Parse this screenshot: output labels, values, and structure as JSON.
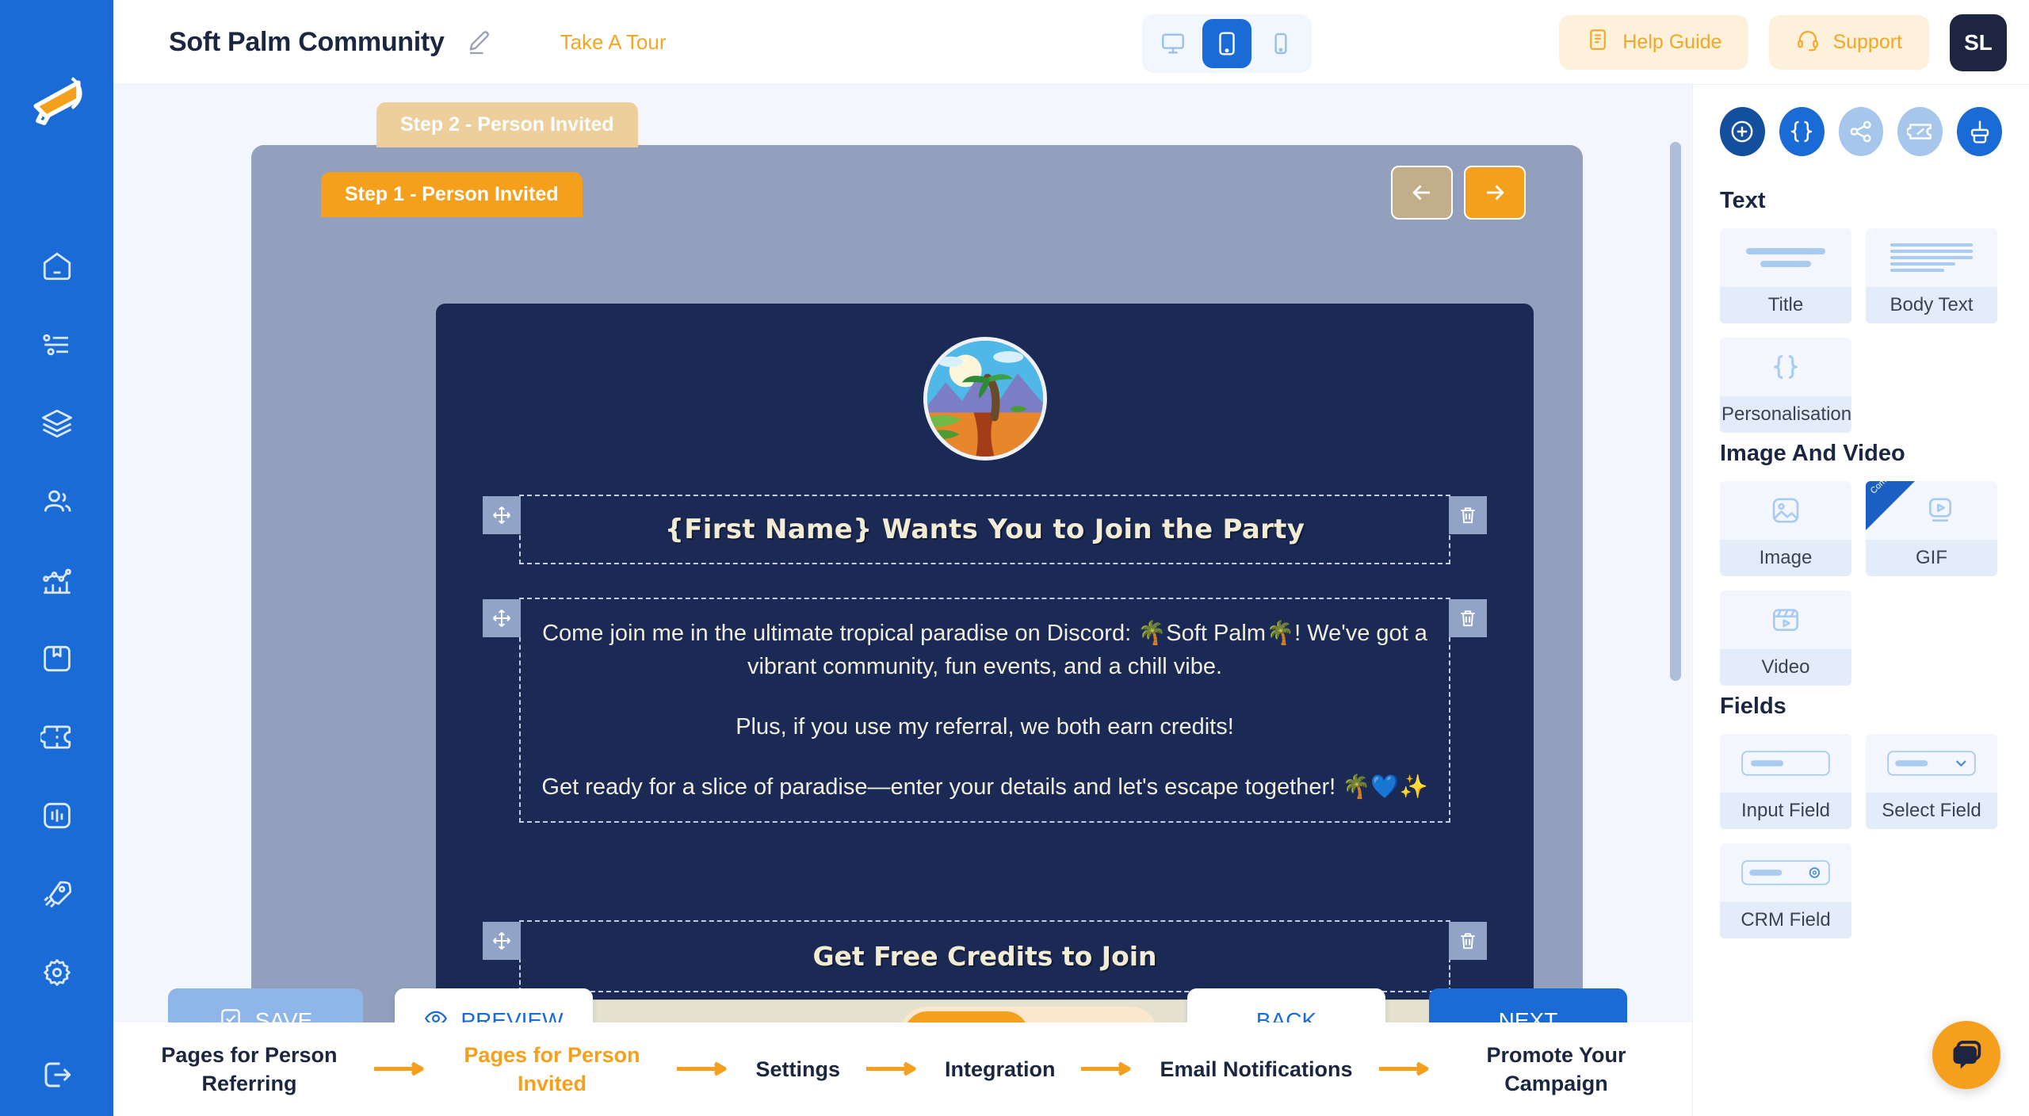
{
  "app": {
    "brand_title": "Soft Palm Community",
    "take_tour": "Take A Tour",
    "help_guide": "Help Guide",
    "support": "Support",
    "avatar_initials": "SL",
    "accent_blue": "#1b6bd6",
    "accent_orange": "#f5a01c",
    "canvas_navy": "#1b2a55",
    "frame_grey": "#93a0bd"
  },
  "device_toggle": {
    "options": [
      "desktop",
      "tablet",
      "mobile"
    ],
    "selected": "tablet"
  },
  "sidebar": {
    "logo": "megaphone-logo",
    "items": [
      {
        "icon": "home-icon",
        "name": "home"
      },
      {
        "icon": "list-icon",
        "name": "campaigns"
      },
      {
        "icon": "layers-icon",
        "name": "pages"
      },
      {
        "icon": "users-icon",
        "name": "audience"
      },
      {
        "icon": "analytics-icon",
        "name": "analytics"
      },
      {
        "icon": "box-icon",
        "name": "rewards"
      },
      {
        "icon": "ticket-icon",
        "name": "coupons"
      },
      {
        "icon": "barchart-icon",
        "name": "reports"
      },
      {
        "icon": "rocket-icon",
        "name": "launch"
      },
      {
        "icon": "gear-icon",
        "name": "settings"
      }
    ],
    "bottom_item": {
      "icon": "logout-icon",
      "name": "logout"
    }
  },
  "canvas": {
    "tab_inactive": "Step 2 - Person Invited",
    "tab_active": "Step 1 - Person Invited",
    "nav_prev": "←",
    "nav_next": "→",
    "logo_alt": "tropical-island-logo",
    "headline": "{First Name} Wants You to Join the Party",
    "body_paragraphs": [
      "Come join me in the ultimate tropical paradise on Discord: 🌴Soft Palm🌴! We've got a vibrant community, fun events, and a chill vibe.",
      "Plus, if you use my referral, we both earn credits!",
      "Get ready for a slice of paradise—enter your details and let's escape together! 🌴💙✨"
    ],
    "cta_heading": "Get Free Credits to Join",
    "input_placeholder": ""
  },
  "step_toggle": {
    "steps": [
      "Step 1",
      "Step 2"
    ],
    "selected": "Step 1"
  },
  "actions": {
    "save": "SAVE",
    "preview": "PREVIEW",
    "back": "BACK",
    "next": "NEXT"
  },
  "breadcrumb": {
    "items": [
      {
        "label": "Pages for Person Referring",
        "active": false
      },
      {
        "label": "Pages for Person Invited",
        "active": true
      },
      {
        "label": "Settings",
        "active": false
      },
      {
        "label": "Integration",
        "active": false
      },
      {
        "label": "Email Notifications",
        "active": false
      },
      {
        "label": "Promote Your Campaign",
        "active": false
      }
    ]
  },
  "right_panel": {
    "circle_actions": [
      {
        "icon": "plus-circle-icon",
        "color": "#144f9e"
      },
      {
        "icon": "braces-icon",
        "color": "#1b6bd6"
      },
      {
        "icon": "share-icon",
        "color": "#a6c6ec"
      },
      {
        "icon": "coupon-icon",
        "color": "#a6c6ec"
      },
      {
        "icon": "brush-icon",
        "color": "#1b6bd6"
      }
    ],
    "sections": [
      {
        "title": "Text",
        "cards": [
          {
            "label": "Title",
            "art": "title-art"
          },
          {
            "label": "Body Text",
            "art": "body-art"
          },
          {
            "label": "Personalisation",
            "art": "braces-art"
          }
        ]
      },
      {
        "title": "Image And Video",
        "cards": [
          {
            "label": "Image",
            "art": "image-art"
          },
          {
            "label": "GIF",
            "art": "gif-art",
            "ribbon": "Coming soon"
          },
          {
            "label": "Video",
            "art": "video-art"
          }
        ]
      },
      {
        "title": "Fields",
        "cards": [
          {
            "label": "Input Field",
            "art": "input-art"
          },
          {
            "label": "Select Field",
            "art": "select-art"
          },
          {
            "label": "CRM Field",
            "art": "crm-art"
          }
        ]
      }
    ]
  },
  "chat_fab": {
    "icon": "chat-icon"
  }
}
